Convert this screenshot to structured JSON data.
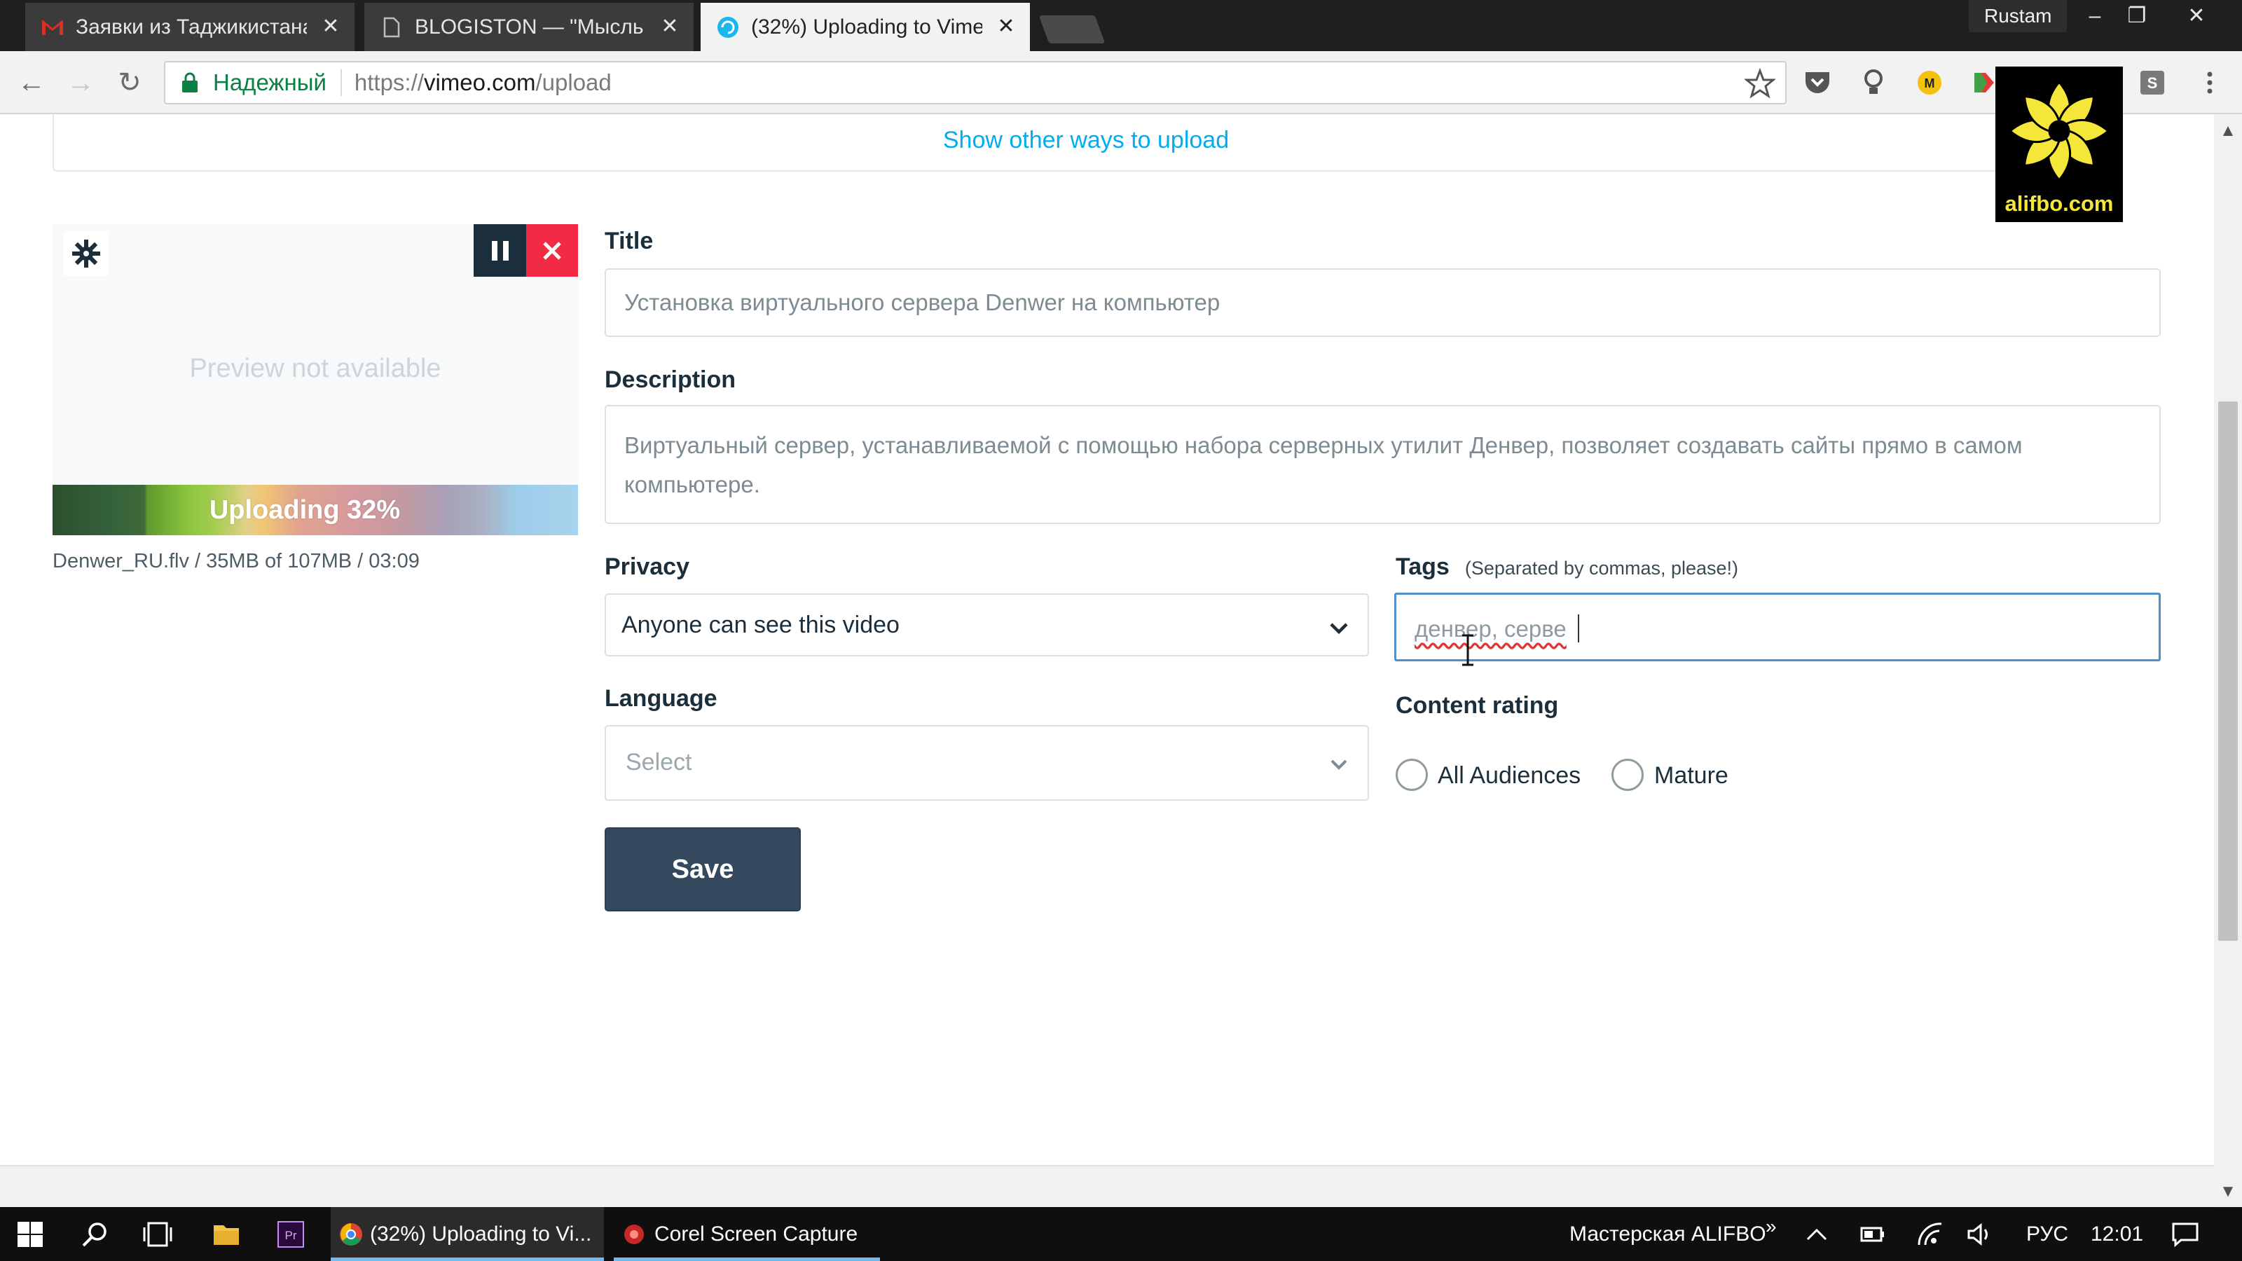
{
  "browser": {
    "tabs": [
      {
        "title": "Заявки из Таджикистана",
        "favicon": "gmail-icon"
      },
      {
        "title": "BLOGISTON — \"Мысль",
        "favicon": "page-icon"
      },
      {
        "title": "(32%) Uploading to Vime",
        "favicon": "loading-icon"
      }
    ],
    "user": "Rustam",
    "address": {
      "secure_label": "Надежный",
      "url_scheme": "https://",
      "url_host": "vimeo.com",
      "url_path": "/upload"
    }
  },
  "page": {
    "other_ways_link": "Show other ways to upload",
    "preview": {
      "message": "Preview not available",
      "upload_label": "Uploading 32%",
      "progress_fraction": 0.32,
      "file_info": "Denwer_RU.flv / 35MB of 107MB / 03:09"
    },
    "form": {
      "title_label": "Title",
      "title_value": "Установка виртуального сервера Denwer на компьютер",
      "description_label": "Description",
      "description_value": "Виртуальный сервер, устанавливаемой с помощью набора серверных утилит Денвер, позволяет создавать сайты прямо в самом компьютере.",
      "privacy_label": "Privacy",
      "privacy_value": "Anyone can see this video",
      "tags_label": "Tags",
      "tags_hint": "(Separated by commas, please!)",
      "tags_value": "денвер, серве",
      "language_label": "Language",
      "language_placeholder": "Select",
      "content_rating_label": "Content rating",
      "rating_options": [
        "All Audiences",
        "Mature"
      ],
      "save_label": "Save"
    }
  },
  "watermark": {
    "text": "alifbo.com"
  },
  "taskbar": {
    "apps": [
      {
        "label": "(32%) Uploading to Vi..."
      },
      {
        "label": "Corel Screen Capture"
      }
    ],
    "tray_text": "Мастерская ALIFBO",
    "language": "РУС",
    "time": "12:01"
  },
  "colors": {
    "accent_link": "#00adef",
    "save_button": "#34495e",
    "cancel_red": "#f32a43",
    "focus_border": "#4f8fcc"
  }
}
